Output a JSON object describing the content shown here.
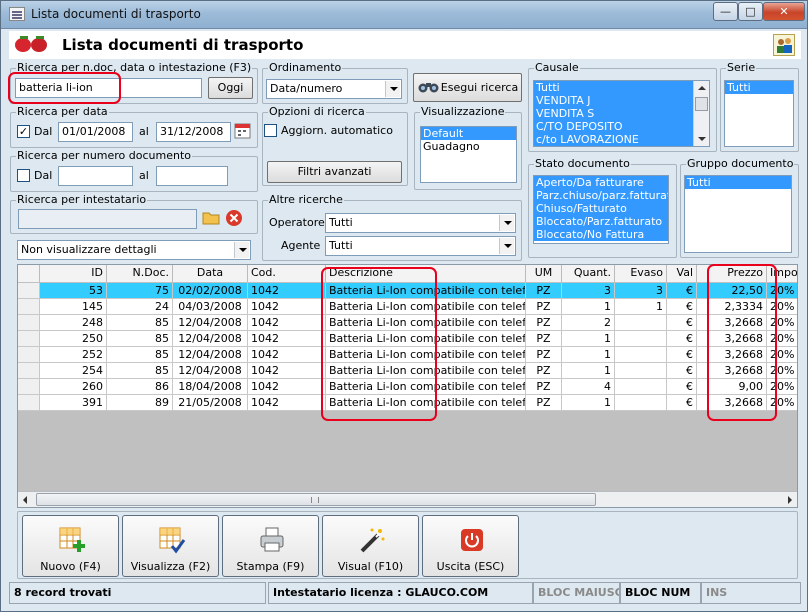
{
  "window": {
    "title": "Lista documenti di trasporto",
    "min": "—",
    "max": "□",
    "close": "✕"
  },
  "header": {
    "title": "Lista documenti di trasporto"
  },
  "search": {
    "label": "Ricerca per n.doc, data o intestazione (F3)",
    "value": "batteria li-ion",
    "today_button": "Oggi"
  },
  "ordinamento": {
    "label": "Ordinamento",
    "value": "Data/numero"
  },
  "esegui_button": "Esegui ricerca",
  "causale": {
    "label": "Causale",
    "options": [
      "Tutti",
      "VENDITA J",
      "VENDITA S",
      "C/TO DEPOSITO",
      "c/to LAVORAZIONE"
    ]
  },
  "serie": {
    "label": "Serie",
    "options": [
      "Tutti"
    ]
  },
  "data": {
    "label": "Ricerca per data",
    "dal_label": "Dal",
    "dal_checked": "✓",
    "dal_value": "01/01/2008",
    "al_label": "al",
    "al_value": "31/12/2008"
  },
  "opzioni": {
    "label": "Opzioni di ricerca",
    "auto_label": "Aggiorn. automatico",
    "filtri_button": "Filtri avanzati"
  },
  "visualizzazione": {
    "label": "Visualizzazione",
    "options": [
      "Default",
      "Guadagno"
    ]
  },
  "numero": {
    "label": "Ricerca per numero documento",
    "dal_label": "Dal",
    "al_label": "al"
  },
  "stato": {
    "label": "Stato documento",
    "options": [
      "Aperto/Da fatturare",
      "Parz.chiuso/parz.fatturato",
      "Chiuso/Fatturato",
      "Bloccato/Parz.fatturato",
      "Bloccato/No Fattura"
    ]
  },
  "gruppo": {
    "label": "Gruppo documento",
    "options": [
      "Tutti"
    ]
  },
  "intestatario": {
    "label": "Ricerca per intestatario"
  },
  "dettagli": {
    "value": "Non visualizzare dettagli"
  },
  "altre": {
    "label": "Altre ricerche",
    "operatore_label": "Operatore :",
    "operatore_value": "Tutti",
    "agente_label": "Agente :",
    "agente_value": "Tutti"
  },
  "grid": {
    "columns": [
      "ID",
      "N.Doc.",
      "Data",
      "Cod.",
      "Descrizione",
      "UM",
      "Quant.",
      "Evaso",
      "Val",
      "Prezzo",
      "Impos"
    ],
    "rows": [
      [
        "53",
        "75",
        "02/02/2008",
        "1042",
        "Batteria Li-Ion compatibile con telefoni ...",
        "PZ",
        "3",
        "3",
        "€",
        "22,50",
        "20%"
      ],
      [
        "145",
        "24",
        "04/03/2008",
        "1042",
        "Batteria Li-Ion compatibile con telefoni ...",
        "PZ",
        "1",
        "1",
        "€",
        "2,3334",
        "20%"
      ],
      [
        "248",
        "85",
        "12/04/2008",
        "1042",
        "Batteria Li-Ion compatibile con telefoni ...",
        "PZ",
        "2",
        "",
        "€",
        "3,2668",
        "20%"
      ],
      [
        "250",
        "85",
        "12/04/2008",
        "1042",
        "Batteria Li-Ion compatibile con telefoni ...",
        "PZ",
        "1",
        "",
        "€",
        "3,2668",
        "20%"
      ],
      [
        "252",
        "85",
        "12/04/2008",
        "1042",
        "Batteria Li-Ion compatibile con telefoni ...",
        "PZ",
        "1",
        "",
        "€",
        "3,2668",
        "20%"
      ],
      [
        "254",
        "85",
        "12/04/2008",
        "1042",
        "Batteria Li-Ion compatibile con telefoni ...",
        "PZ",
        "1",
        "",
        "€",
        "3,2668",
        "20%"
      ],
      [
        "260",
        "86",
        "18/04/2008",
        "1042",
        "Batteria Li-Ion compatibile con telefoni ...",
        "PZ",
        "4",
        "",
        "€",
        "9,00",
        "20%"
      ],
      [
        "391",
        "89",
        "21/05/2008",
        "1042",
        "Batteria Li-Ion compatibile con telefoni ...",
        "PZ",
        "1",
        "",
        "€",
        "3,2668",
        "20%"
      ]
    ]
  },
  "toolbar": {
    "nuovo": "Nuovo (F4)",
    "visualizza": "Visualizza (F2)",
    "stampa": "Stampa (F9)",
    "visual": "Visual (F10)",
    "uscita": "Uscita (ESC)"
  },
  "status": {
    "records": "8 record trovati",
    "licenza": "Intestatario licenza : GLAUCO.COM",
    "maiusc": "BLOC MAIUSC",
    "num": "BLOC NUM",
    "ins": "INS"
  },
  "colors": {
    "selected_row": "#33ccff",
    "list_selection": "#3399ff",
    "highlight_box": "#e8001c"
  }
}
